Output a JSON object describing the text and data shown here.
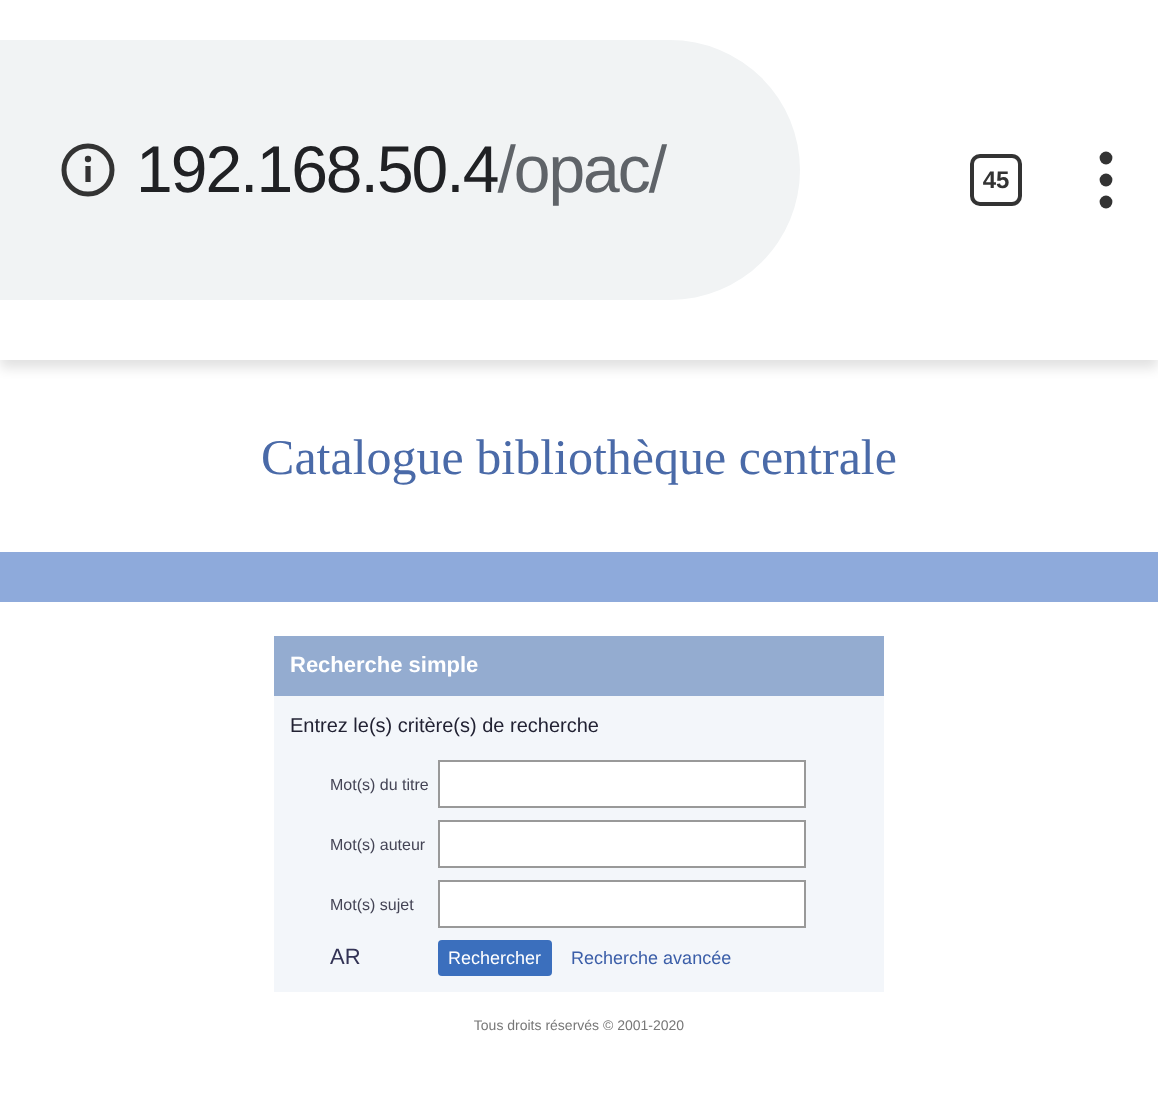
{
  "browser": {
    "url_host": "192.168.50.4",
    "url_path": "/opac/",
    "tab_count": "45"
  },
  "page": {
    "title": "Catalogue bibliothèque centrale"
  },
  "search_panel": {
    "header": "Recherche simple",
    "instruction": "Entrez le(s) critère(s) de recherche",
    "fields": [
      {
        "label": "Mot(s) du titre"
      },
      {
        "label": "Mot(s) auteur"
      },
      {
        "label": "Mot(s) sujet"
      }
    ],
    "ar_label": "AR",
    "search_button": "Rechercher",
    "advanced_link": "Recherche avancée"
  },
  "footer": "Tous droits réservés © 2001-2020"
}
